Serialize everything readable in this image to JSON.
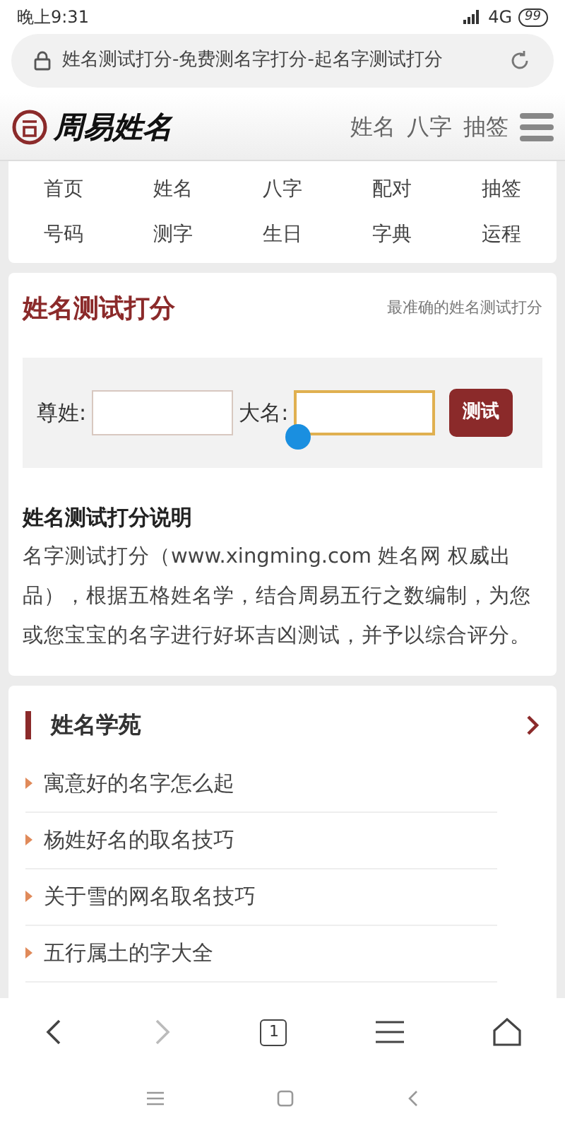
{
  "status_bar": {
    "time": "晚上9:31",
    "network": "4G",
    "battery": "99"
  },
  "address_bar": {
    "title": "姓名测试打分-免费测名字打分-起名字测试打分"
  },
  "header": {
    "logo_text": "周易姓名",
    "links": [
      "姓名",
      "八字",
      "抽签"
    ]
  },
  "nav_grid": [
    "首页",
    "姓名",
    "八字",
    "配对",
    "抽签",
    "号码",
    "测字",
    "生日",
    "字典",
    "运程"
  ],
  "test_card": {
    "title": "姓名测试打分",
    "subtitle": "最准确的姓名测试打分",
    "surname_label": "尊姓:",
    "name_label": "大名:",
    "submit": "测试",
    "info_title": "姓名测试打分说明",
    "info_text": "名字测试打分（www.xingming.com 姓名网 权威出品），根据五格姓名学，结合周易五行之数编制，为您或您宝宝的名字进行好坏吉凶测试，并予以综合评分。"
  },
  "articles": {
    "title": "姓名学苑",
    "items": [
      "寓意好的名字怎么起",
      "杨姓好名的取名技巧",
      "关于雪的网名取名技巧",
      "五行属土的字大全"
    ]
  },
  "browser_toolbar": {
    "tab_count": "1"
  }
}
